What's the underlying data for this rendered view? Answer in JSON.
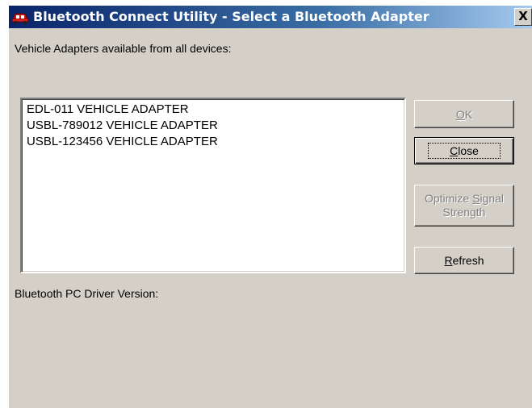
{
  "window": {
    "title": "Bluetooth Connect Utility - Select a Bluetooth Adapter",
    "close_glyph": "X",
    "icon": "red-car-icon"
  },
  "adapters_label": "Vehicle Adapters available from all devices:",
  "adapter_list": [
    "EDL-011 VEHICLE ADAPTER",
    "USBL-789012 VEHICLE ADAPTER",
    "USBL-123456 VEHICLE ADAPTER"
  ],
  "buttons": {
    "ok": {
      "mnemonic": "O",
      "rest": "K",
      "enabled": false
    },
    "close": {
      "mnemonic": "C",
      "rest": "lose",
      "enabled": true,
      "default": true
    },
    "optimize": {
      "line1_pre": "Optimize ",
      "line1_mnemonic": "S",
      "line1_post": "ignal",
      "line2": "Strength",
      "enabled": false
    },
    "refresh": {
      "mnemonic": "R",
      "rest": "efresh",
      "enabled": true
    }
  },
  "driver_version_label": "Bluetooth PC Driver Version:",
  "driver_version_value": "",
  "colors": {
    "face": "#d4d0c8",
    "title_start": "#0a246a",
    "title_end": "#a6caf0",
    "disabled_text": "#808080"
  }
}
